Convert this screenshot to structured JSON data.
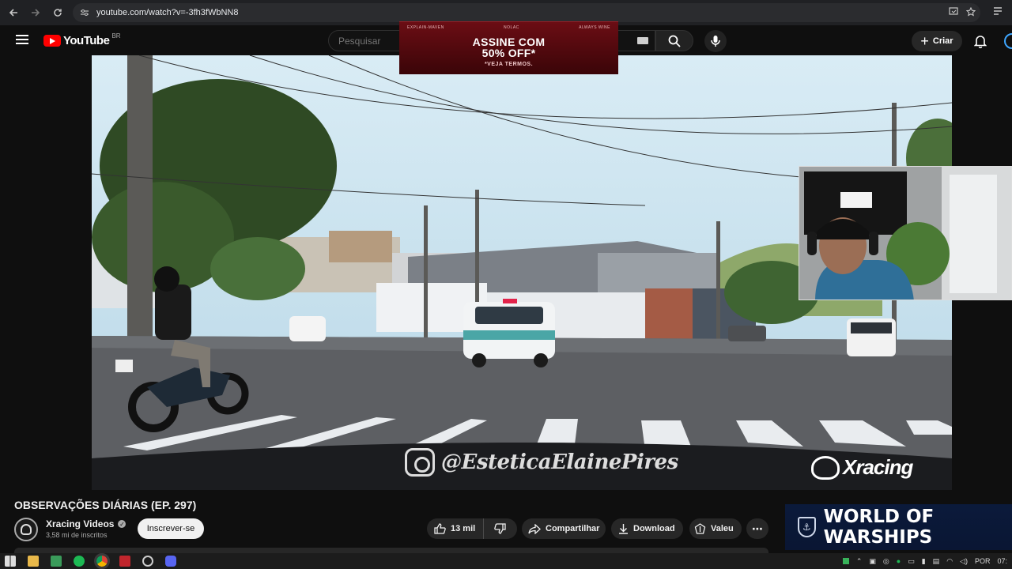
{
  "browser": {
    "url": "youtube.com/watch?v=-3fh3fWbNN8",
    "back_icon": "arrow-left-icon",
    "forward_icon": "arrow-right-icon",
    "reload_icon": "reload-icon"
  },
  "youtube": {
    "logo_text": "YouTube",
    "region": "BR",
    "search_placeholder": "Pesquisar",
    "create_label": "Criar"
  },
  "ad": {
    "top_left": "EXPLAIN-MAVEN",
    "top_center": "NOLAC",
    "top_right": "ALWAYS WINE",
    "headline_1": "ASSINE COM",
    "headline_2": "50% OFF*",
    "subline": "*VEJA TERMOS."
  },
  "video": {
    "watermark_text": "@EsteticaElainePires",
    "brand_overlay": "Xracing",
    "title": "OBSERVAÇÕES DIÁRIAS (EP. 297)"
  },
  "channel": {
    "name": "Xracing Videos",
    "subscribers": "3,58 mi de inscritos",
    "subscribe_label": "Inscrever-se"
  },
  "actions": {
    "likes": "13 mil",
    "share": "Compartilhar",
    "download": "Download",
    "thanks": "Valeu",
    "more": "⋯"
  },
  "sidebar_ad": {
    "text": "WORLD OF WARSHIPS"
  },
  "taskbar": {
    "language": "POR",
    "time": "07:"
  },
  "colors": {
    "brand_red": "#ff0000",
    "page_bg": "#0f0f0f",
    "pill_bg": "#272727"
  }
}
